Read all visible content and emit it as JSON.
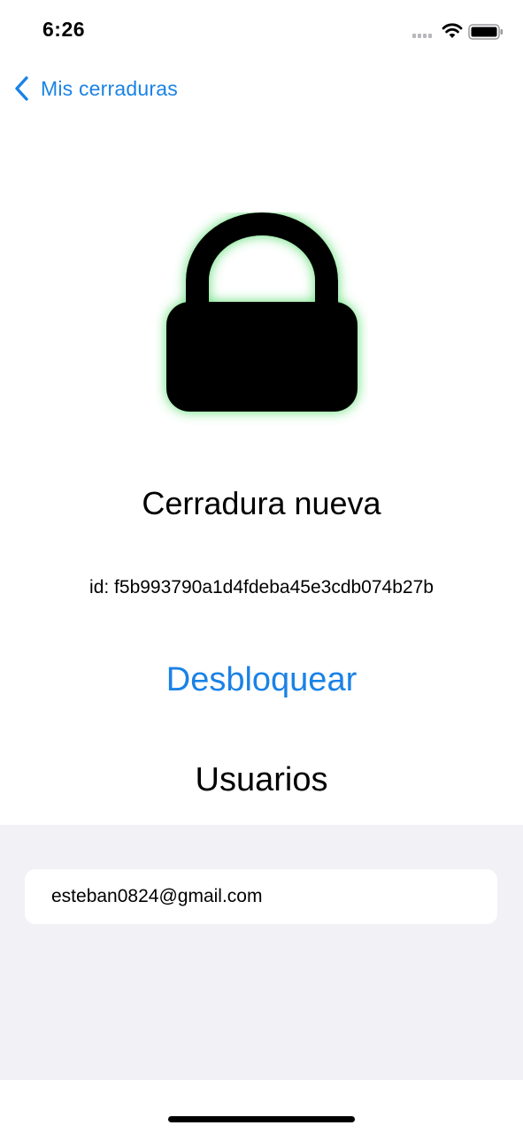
{
  "status_bar": {
    "time": "6:26",
    "icons": [
      "cellular-signal-icon",
      "wifi-icon",
      "battery-icon"
    ]
  },
  "nav": {
    "back_label": "Mis cerraduras",
    "back_icon": "chevron-left-icon"
  },
  "lock": {
    "icon": "lock-icon",
    "status": "locked",
    "glow_color": "#4cd964",
    "title": "Cerradura nueva",
    "id_text": "id: f5b993790a1d4fdeba45e3cdb074b27b"
  },
  "actions": {
    "unlock_label": "Desbloquear"
  },
  "users": {
    "heading": "Usuarios",
    "list": [
      {
        "email": "esteban0824@gmail.com"
      }
    ]
  },
  "colors": {
    "accent": "#1a82e6",
    "grouped_background": "#f1f1f6"
  }
}
